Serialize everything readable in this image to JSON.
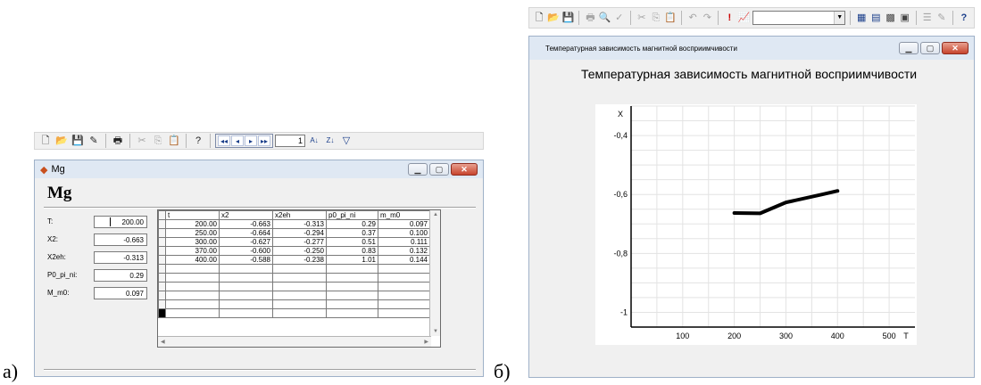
{
  "left": {
    "label": "а)",
    "toolbar": {
      "buttons": [
        "new-icon",
        "open-icon",
        "save-icon",
        "edit-icon",
        "print-icon",
        "cut-icon",
        "copy-icon",
        "paste-icon",
        "help-icon"
      ],
      "nav": [
        "◂◂",
        "◂",
        "▸",
        "▸▸"
      ],
      "record": "1",
      "sort_asc": "A↓",
      "sort_desc": "Z↓",
      "filter": "filter-icon"
    },
    "window": {
      "title": "Mg",
      "heading": "Mg",
      "fields": [
        {
          "label": "T:",
          "value": "200.00"
        },
        {
          "label": "X2:",
          "value": "-0.663"
        },
        {
          "label": "X2eh:",
          "value": "-0.313"
        },
        {
          "label": "P0_pi_ni:",
          "value": "0.29"
        },
        {
          "label": "M_m0:",
          "value": "0.097"
        }
      ],
      "grid": {
        "columns": [
          "t",
          "x2",
          "x2eh",
          "p0_pi_ni",
          "m_m0"
        ],
        "rows": [
          [
            "200.00",
            "-0.663",
            "-0.313",
            "0.29",
            "0.097"
          ],
          [
            "250.00",
            "-0.664",
            "-0.294",
            "0.37",
            "0.100"
          ],
          [
            "300.00",
            "-0.627",
            "-0.277",
            "0.51",
            "0.111"
          ],
          [
            "370.00",
            "-0.600",
            "-0.250",
            "0.83",
            "0.132"
          ],
          [
            "400.00",
            "-0.588",
            "-0.238",
            "1.01",
            "0.144"
          ]
        ]
      }
    }
  },
  "right": {
    "label": "б)",
    "toolbar": {
      "buttons": [
        "new-icon",
        "open-icon",
        "save-icon",
        "print-icon",
        "print-preview-icon",
        "spell-icon",
        "cut-icon",
        "copy-icon",
        "paste-icon",
        "undo-icon",
        "redo-icon",
        "run-icon",
        "chart-wizard-icon"
      ],
      "combo_value": "",
      "buttons2": [
        "table-icon",
        "chart-icon",
        "chart-type-icon",
        "chart-format-icon",
        "legend-icon",
        "properties-icon",
        "help-icon"
      ]
    },
    "window": {
      "title": "Температурная зависимость магнитной восприимчивости"
    }
  },
  "chart_data": {
    "type": "line",
    "title": "Температурная зависимость магнитной восприимчивости",
    "xlabel": "T",
    "ylabel": "X",
    "xlim": [
      0,
      550
    ],
    "ylim": [
      -1.05,
      -0.3
    ],
    "xticks": [
      100,
      200,
      300,
      400,
      500
    ],
    "yticks": [
      -0.4,
      -0.6,
      -0.8,
      -1
    ],
    "xtick_labels": [
      "100",
      "200",
      "300",
      "400",
      "500"
    ],
    "ytick_labels": [
      "-0,4",
      "-0,6",
      "-0,8",
      "-1"
    ],
    "grid": true,
    "series": [
      {
        "x": [
          200,
          250,
          300,
          370,
          400
        ],
        "y": [
          -0.663,
          -0.664,
          -0.627,
          -0.6,
          -0.588
        ]
      }
    ]
  }
}
